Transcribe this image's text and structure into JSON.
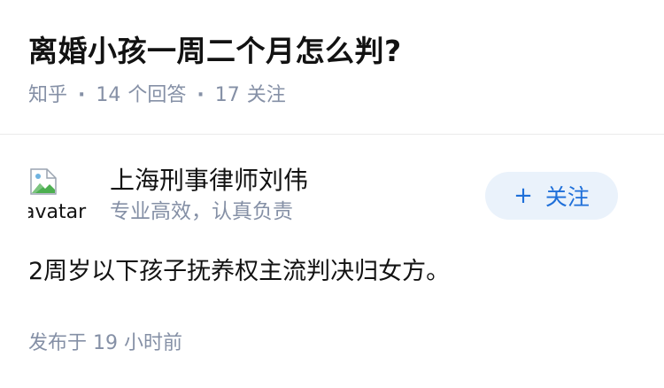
{
  "question": {
    "title": "离婚小孩一周二个月怎么判?",
    "source": "知乎",
    "answer_count": "14",
    "answer_label": "个回答",
    "follower_count": "17",
    "follower_label": "关注"
  },
  "answer": {
    "author": {
      "avatar_alt": "avatar",
      "name": "上海刑事律师刘伟",
      "headline": "专业高效，认真负责"
    },
    "follow_button": {
      "icon": "+",
      "label": "关注"
    },
    "content": "2周岁以下孩子抚养权主流判决归女方。",
    "published": "发布于  19 小时前"
  },
  "colors": {
    "primary_text": "#121212",
    "meta_text": "#8590a6",
    "follow_bg": "#eaf2fb",
    "follow_text": "#1e6fd9",
    "divider": "#ebebeb"
  }
}
